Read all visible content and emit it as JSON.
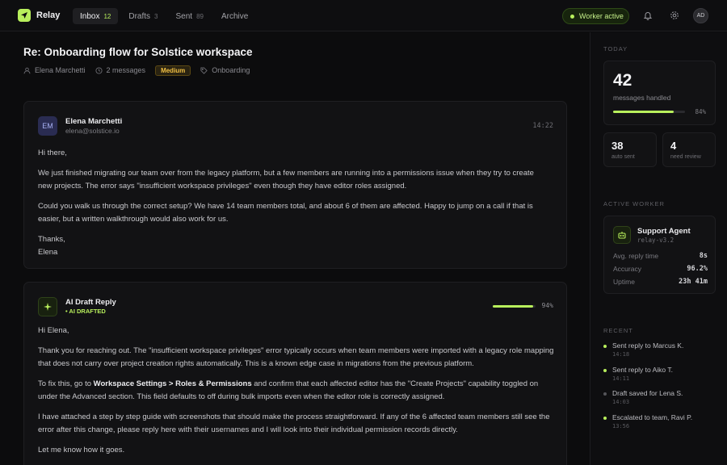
{
  "app": {
    "name": "Relay"
  },
  "nav": {
    "tabs": [
      {
        "label": "Inbox",
        "count": "12"
      },
      {
        "label": "Drafts",
        "count": "3"
      },
      {
        "label": "Sent",
        "count": "89"
      },
      {
        "label": "Archive",
        "count": ""
      }
    ]
  },
  "status": {
    "worker_label": "Worker active"
  },
  "user": {
    "initials": "AD"
  },
  "thread": {
    "subject": "Re: Onboarding flow for Solstice workspace",
    "from_name": "Elena Marchetti",
    "message_count": "2 messages",
    "priority": "Medium",
    "tag": "Onboarding"
  },
  "message": {
    "avatar": "EM",
    "sender": "Elena Marchetti",
    "email": "elena@solstice.io",
    "time": "14:22",
    "paragraphs": [
      "Hi there,",
      "We just finished migrating our team over from the legacy platform, but a few members are running into a permissions issue when they try to create new projects. The error says \"insufficient workspace privileges\" even though they have editor roles assigned.",
      "Could you walk us through the correct setup? We have 14 team members total, and about 6 of them are affected. Happy to jump on a call if that is easier, but a written walkthrough would also work for us.",
      "Thanks,",
      "Elena"
    ]
  },
  "draft": {
    "title": "AI Draft Reply",
    "status": "• AI DRAFTED",
    "confidence": 0.94,
    "confidence_label": "94%",
    "greeting": "Hi Elena,",
    "p1": "Thank you for reaching out. The \"insufficient workspace privileges\" error typically occurs when team members were imported with a legacy role mapping that does not carry over project creation rights automatically. This is a known edge case in migrations from the previous platform.",
    "p2_pre": "To fix this, go to ",
    "p2_bold": "Workspace Settings > Roles & Permissions",
    "p2_post": " and confirm that each affected editor has the \"Create Projects\" capability toggled on under the Advanced section. This field defaults to off during bulk imports even when the editor role is correctly assigned.",
    "p3": "I have attached a step by step guide with screenshots that should make the process straightforward. If any of the 6 affected team members still see the error after this change, please reply here with their usernames and I will look into their individual permission records directly.",
    "p4": "Let me know how it goes."
  },
  "sidebar": {
    "today_title": "TODAY",
    "handled_count": "42",
    "handled_label": "messages handled",
    "handled_fraction": 0.84,
    "handled_pct": "84%",
    "auto_sent_count": "38",
    "auto_sent_label": "auto sent",
    "review_count": "4",
    "review_label": "need review",
    "worker_title": "ACTIVE WORKER",
    "worker_name": "Support Agent",
    "worker_version": "relay-v3.2",
    "stats": [
      {
        "label": "Avg. reply time",
        "value": "8s"
      },
      {
        "label": "Accuracy",
        "value": "96.2%"
      },
      {
        "label": "Uptime",
        "value": "23h 41m"
      }
    ],
    "recent_title": "RECENT",
    "recent": [
      {
        "text": "Sent reply to Marcus K.",
        "time": "14:18",
        "muted": false
      },
      {
        "text": "Sent reply to Aiko T.",
        "time": "14:11",
        "muted": false
      },
      {
        "text": "Draft saved for Lena S.",
        "time": "14:03",
        "muted": true
      },
      {
        "text": "Escalated to team, Ravi P.",
        "time": "13:56",
        "muted": false
      }
    ]
  },
  "colors": {
    "accent": "#b8ef5c",
    "background": "#0c0c0d",
    "priority": "#f1c043"
  }
}
